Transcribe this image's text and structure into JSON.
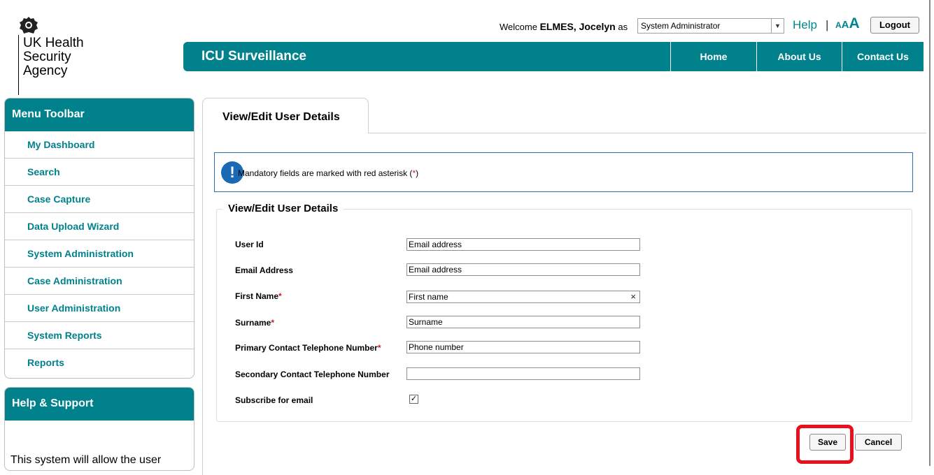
{
  "agency": {
    "line1": "UK Health",
    "line2": "Security",
    "line3": "Agency",
    "crest_icon": "royal-crest-icon"
  },
  "top_bar": {
    "welcome_prefix": "Welcome",
    "user_name": "ELMES, Jocelyn",
    "as_label": "as",
    "role_value": "System Administrator",
    "help_label": "Help",
    "separator": "|",
    "text_size_small": "A",
    "text_size_medium": "A",
    "text_size_large": "A",
    "logout_label": "Logout"
  },
  "header": {
    "title": "ICU Surveillance",
    "nav": [
      "Home",
      "About Us",
      "Contact Us"
    ],
    "color": "#00818c"
  },
  "sidebar": {
    "menu_title": "Menu Toolbar",
    "items": [
      "My Dashboard",
      "Search",
      "Case Capture",
      "Data Upload Wizard",
      "System Administration",
      "Case Administration",
      "User Administration",
      "System Reports",
      "Reports"
    ],
    "help_title": "Help & Support",
    "help_text": "This system will allow the user"
  },
  "main": {
    "tab_label": "View/Edit User Details",
    "info_text": "Mandatory fields are marked with red asterisk (",
    "info_asterisk": "*",
    "info_close": ")",
    "fieldset_legend": "View/Edit User Details",
    "fields": [
      {
        "label": "User Id",
        "required": "",
        "value": "Email address"
      },
      {
        "label": "Email Address",
        "required": "",
        "value": "Email address"
      },
      {
        "label": "First Name",
        "required": "*",
        "value": "First name"
      },
      {
        "label": "Surname",
        "required": "*",
        "value": "Surname"
      },
      {
        "label": "Primary Contact Telephone Number",
        "required": "*",
        "value": "Phone number"
      },
      {
        "label": "Secondary Contact Telephone Number",
        "required": "",
        "value": ""
      }
    ],
    "clear_icon": "×",
    "subscribe_label": "Subscribe for email",
    "subscribe_checked": "✓",
    "save_label": "Save",
    "cancel_label": "Cancel"
  },
  "colors": {
    "accent": "#00818c",
    "info_border": "#2d6fb5",
    "required": "#d01c1c",
    "highlight": "#e8101c"
  }
}
